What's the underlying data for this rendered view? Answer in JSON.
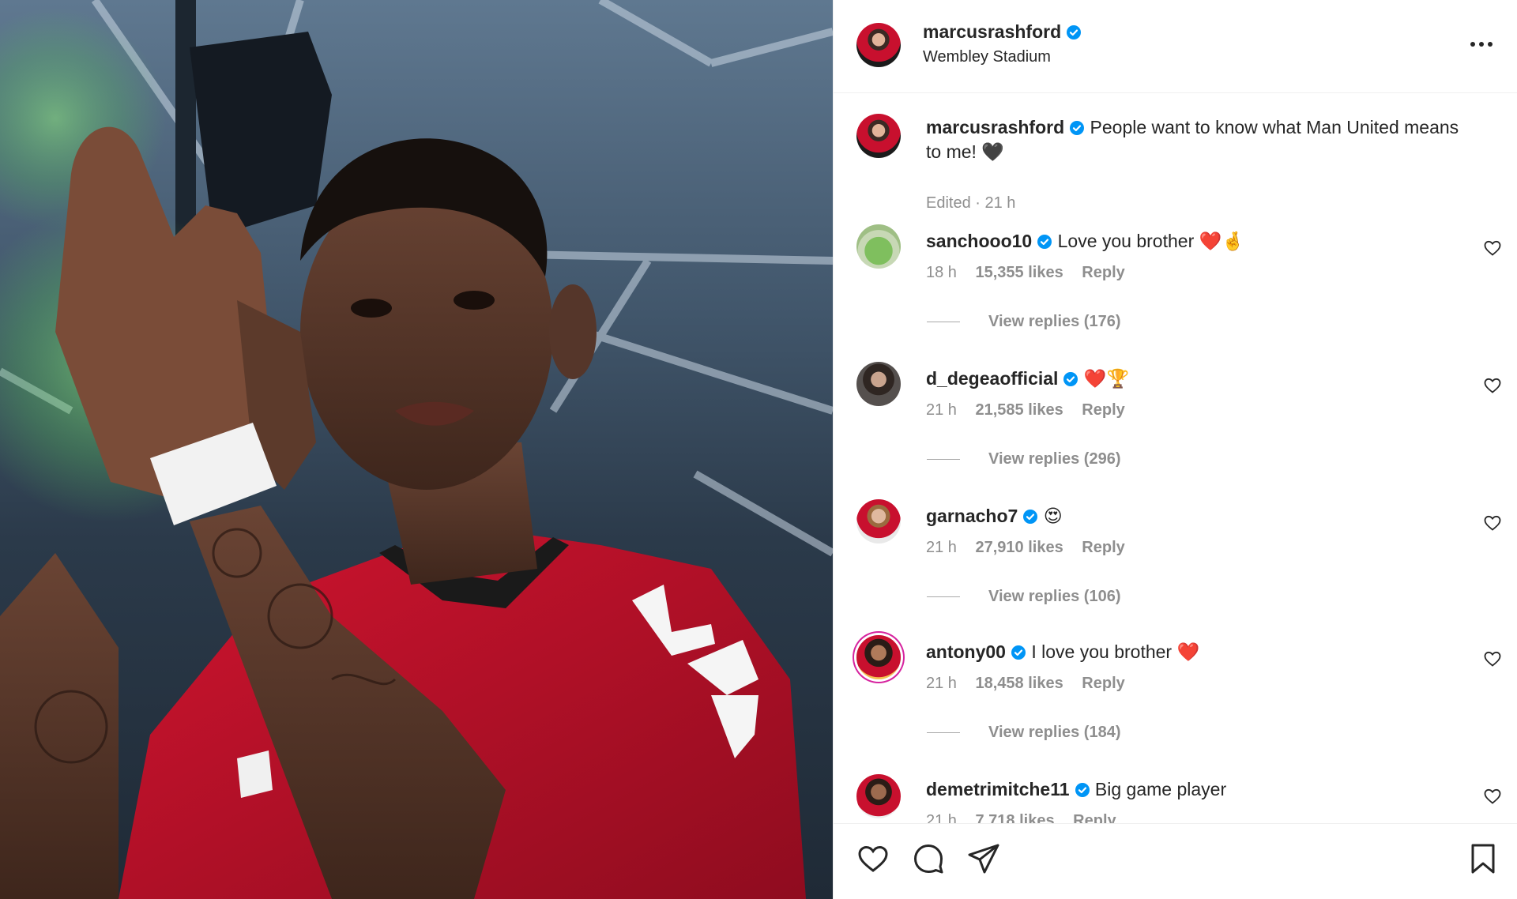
{
  "post": {
    "username": "marcusrashford",
    "location": "Wembley Stadium",
    "caption": "People want to know what Man United means to me! 🖤",
    "edited": "Edited · 21 h"
  },
  "comments": [
    {
      "user": "sanchooo10",
      "text": "Love you brother ❤️🤞",
      "time": "18 h",
      "likes": "15,355 likes",
      "reply": "Reply",
      "view_replies": "View replies (176)"
    },
    {
      "user": "d_degeaofficial",
      "text": "❤️🏆",
      "time": "21 h",
      "likes": "21,585 likes",
      "reply": "Reply",
      "view_replies": "View replies (296)"
    },
    {
      "user": "garnacho7",
      "text": "😍",
      "time": "21 h",
      "likes": "27,910 likes",
      "reply": "Reply",
      "view_replies": "View replies (106)"
    },
    {
      "user": "antony00",
      "text": "I love you brother ❤️",
      "time": "21 h",
      "likes": "18,458 likes",
      "reply": "Reply",
      "view_replies": "View replies (184)"
    },
    {
      "user": "demetrimitche11",
      "text": "Big game player",
      "time": "21 h",
      "likes": "7,718 likes",
      "reply": "Reply"
    }
  ],
  "icons": {
    "verified": "verified-badge-icon",
    "more": "more-options-icon",
    "like": "heart-icon",
    "comment": "comment-icon",
    "share": "share-icon",
    "save": "bookmark-icon"
  },
  "colors": {
    "verified": "#0095f6",
    "kit_red": "#c8102e",
    "muted": "#8e8e8e"
  }
}
